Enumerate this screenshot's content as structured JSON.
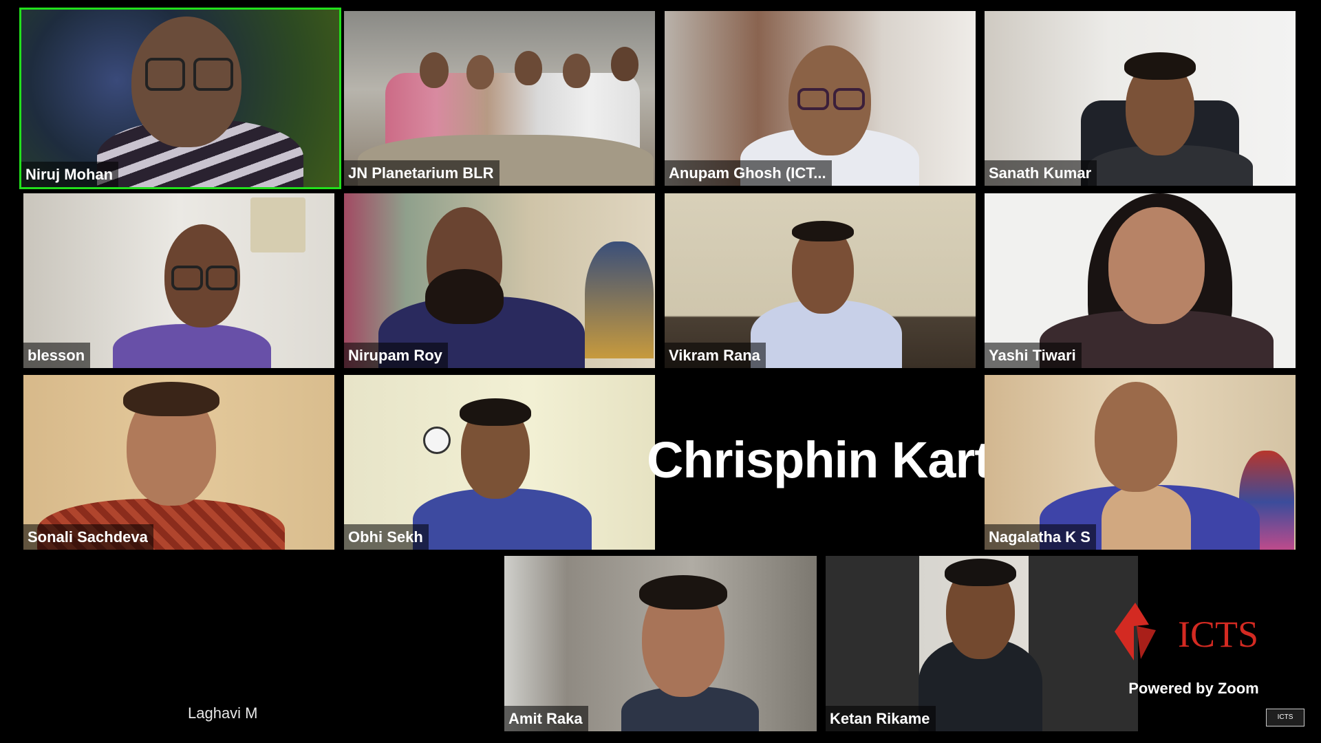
{
  "participants": {
    "niruj": "Niruj Mohan",
    "jn_planetarium": "JN Planetarium BLR",
    "anupam": "Anupam Ghosh (ICT...",
    "sanath": "Sanath Kumar",
    "blesson": "blesson",
    "nirupam": "Nirupam Roy",
    "vikram": "Vikram Rana",
    "yashi": "Yashi Tiwari",
    "sonali": "Sonali Sachdeva",
    "obhi": "Obhi Sekh",
    "chrisphin": "Chrisphin Kart...",
    "nagalatha": "Nagalatha K S",
    "laghavi": "Laghavi M",
    "amit": "Amit Raka",
    "ketan": "Ketan Rikame"
  },
  "branding": {
    "logo_text": "ICTS",
    "powered_by": "Powered by Zoom",
    "watermark": "ICTS"
  },
  "colors": {
    "active_speaker": "#22e01c",
    "background": "#000000",
    "logo_red": "#d32a22"
  }
}
